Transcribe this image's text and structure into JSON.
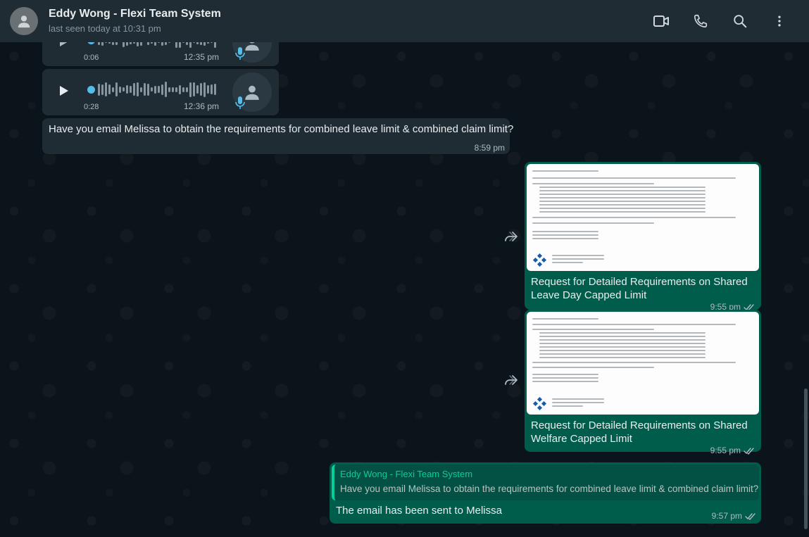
{
  "header": {
    "contact_name": "Eddy Wong - Flexi Team System",
    "last_seen": "last seen today at 10:31 pm",
    "icons": [
      "video-call-icon",
      "voice-call-icon",
      "search-icon",
      "menu-icon"
    ]
  },
  "messages": {
    "voice_1": {
      "duration": "0:06",
      "time": "12:35 pm",
      "played": true
    },
    "voice_2": {
      "duration": "0:28",
      "time": "12:36 pm",
      "played": true
    },
    "incoming_text": {
      "text": "Have you email Melissa to obtain the requirements for combined leave limit & combined claim limit?",
      "time": "8:59 pm"
    },
    "doc_1": {
      "caption": "Request for Detailed Requirements on Shared Leave Day Capped Limit",
      "time": "9:55 pm",
      "status": "read"
    },
    "doc_2": {
      "caption": "Request for Detailed Requirements on Shared Welfare Capped Limit",
      "time": "9:55 pm",
      "status": "read"
    },
    "reply": {
      "quoted_name": "Eddy Wong - Flexi Team System",
      "quoted_text": "Have you email Melissa to obtain the requirements for combined leave limit & combined claim limit?",
      "text": "The email has been sent to Melissa",
      "time": "9:57 pm",
      "status": "read"
    }
  },
  "colors": {
    "header_bg": "#202c33",
    "chat_bg": "#0b141a",
    "incoming_bubble": "#202c33",
    "outgoing_bubble": "#005c4b",
    "accent": "#06cf9c",
    "voice_dot": "#53bdeb"
  }
}
